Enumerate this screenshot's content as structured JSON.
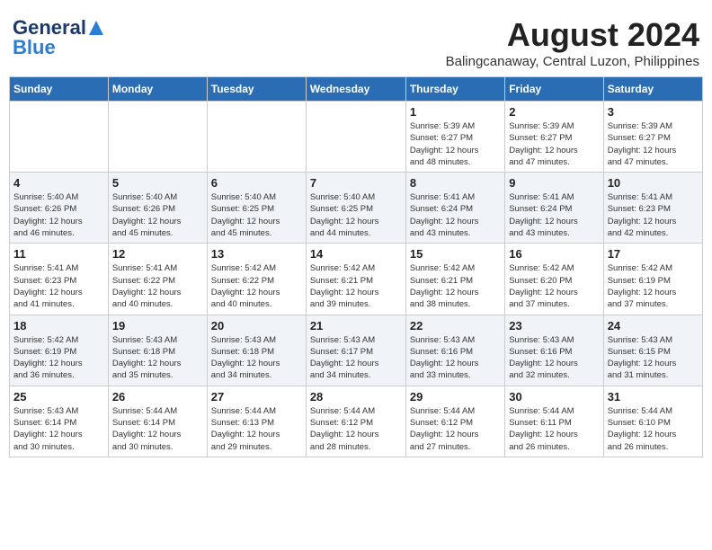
{
  "logo": {
    "line1": "General",
    "line2": "Blue"
  },
  "title": "August 2024",
  "subtitle": "Balingcanaway, Central Luzon, Philippines",
  "days_of_week": [
    "Sunday",
    "Monday",
    "Tuesday",
    "Wednesday",
    "Thursday",
    "Friday",
    "Saturday"
  ],
  "weeks": [
    [
      {
        "day": "",
        "info": ""
      },
      {
        "day": "",
        "info": ""
      },
      {
        "day": "",
        "info": ""
      },
      {
        "day": "",
        "info": ""
      },
      {
        "day": "1",
        "info": "Sunrise: 5:39 AM\nSunset: 6:27 PM\nDaylight: 12 hours\nand 48 minutes."
      },
      {
        "day": "2",
        "info": "Sunrise: 5:39 AM\nSunset: 6:27 PM\nDaylight: 12 hours\nand 47 minutes."
      },
      {
        "day": "3",
        "info": "Sunrise: 5:39 AM\nSunset: 6:27 PM\nDaylight: 12 hours\nand 47 minutes."
      }
    ],
    [
      {
        "day": "4",
        "info": "Sunrise: 5:40 AM\nSunset: 6:26 PM\nDaylight: 12 hours\nand 46 minutes."
      },
      {
        "day": "5",
        "info": "Sunrise: 5:40 AM\nSunset: 6:26 PM\nDaylight: 12 hours\nand 45 minutes."
      },
      {
        "day": "6",
        "info": "Sunrise: 5:40 AM\nSunset: 6:25 PM\nDaylight: 12 hours\nand 45 minutes."
      },
      {
        "day": "7",
        "info": "Sunrise: 5:40 AM\nSunset: 6:25 PM\nDaylight: 12 hours\nand 44 minutes."
      },
      {
        "day": "8",
        "info": "Sunrise: 5:41 AM\nSunset: 6:24 PM\nDaylight: 12 hours\nand 43 minutes."
      },
      {
        "day": "9",
        "info": "Sunrise: 5:41 AM\nSunset: 6:24 PM\nDaylight: 12 hours\nand 43 minutes."
      },
      {
        "day": "10",
        "info": "Sunrise: 5:41 AM\nSunset: 6:23 PM\nDaylight: 12 hours\nand 42 minutes."
      }
    ],
    [
      {
        "day": "11",
        "info": "Sunrise: 5:41 AM\nSunset: 6:23 PM\nDaylight: 12 hours\nand 41 minutes."
      },
      {
        "day": "12",
        "info": "Sunrise: 5:41 AM\nSunset: 6:22 PM\nDaylight: 12 hours\nand 40 minutes."
      },
      {
        "day": "13",
        "info": "Sunrise: 5:42 AM\nSunset: 6:22 PM\nDaylight: 12 hours\nand 40 minutes."
      },
      {
        "day": "14",
        "info": "Sunrise: 5:42 AM\nSunset: 6:21 PM\nDaylight: 12 hours\nand 39 minutes."
      },
      {
        "day": "15",
        "info": "Sunrise: 5:42 AM\nSunset: 6:21 PM\nDaylight: 12 hours\nand 38 minutes."
      },
      {
        "day": "16",
        "info": "Sunrise: 5:42 AM\nSunset: 6:20 PM\nDaylight: 12 hours\nand 37 minutes."
      },
      {
        "day": "17",
        "info": "Sunrise: 5:42 AM\nSunset: 6:19 PM\nDaylight: 12 hours\nand 37 minutes."
      }
    ],
    [
      {
        "day": "18",
        "info": "Sunrise: 5:42 AM\nSunset: 6:19 PM\nDaylight: 12 hours\nand 36 minutes."
      },
      {
        "day": "19",
        "info": "Sunrise: 5:43 AM\nSunset: 6:18 PM\nDaylight: 12 hours\nand 35 minutes."
      },
      {
        "day": "20",
        "info": "Sunrise: 5:43 AM\nSunset: 6:18 PM\nDaylight: 12 hours\nand 34 minutes."
      },
      {
        "day": "21",
        "info": "Sunrise: 5:43 AM\nSunset: 6:17 PM\nDaylight: 12 hours\nand 34 minutes."
      },
      {
        "day": "22",
        "info": "Sunrise: 5:43 AM\nSunset: 6:16 PM\nDaylight: 12 hours\nand 33 minutes."
      },
      {
        "day": "23",
        "info": "Sunrise: 5:43 AM\nSunset: 6:16 PM\nDaylight: 12 hours\nand 32 minutes."
      },
      {
        "day": "24",
        "info": "Sunrise: 5:43 AM\nSunset: 6:15 PM\nDaylight: 12 hours\nand 31 minutes."
      }
    ],
    [
      {
        "day": "25",
        "info": "Sunrise: 5:43 AM\nSunset: 6:14 PM\nDaylight: 12 hours\nand 30 minutes."
      },
      {
        "day": "26",
        "info": "Sunrise: 5:44 AM\nSunset: 6:14 PM\nDaylight: 12 hours\nand 30 minutes."
      },
      {
        "day": "27",
        "info": "Sunrise: 5:44 AM\nSunset: 6:13 PM\nDaylight: 12 hours\nand 29 minutes."
      },
      {
        "day": "28",
        "info": "Sunrise: 5:44 AM\nSunset: 6:12 PM\nDaylight: 12 hours\nand 28 minutes."
      },
      {
        "day": "29",
        "info": "Sunrise: 5:44 AM\nSunset: 6:12 PM\nDaylight: 12 hours\nand 27 minutes."
      },
      {
        "day": "30",
        "info": "Sunrise: 5:44 AM\nSunset: 6:11 PM\nDaylight: 12 hours\nand 26 minutes."
      },
      {
        "day": "31",
        "info": "Sunrise: 5:44 AM\nSunset: 6:10 PM\nDaylight: 12 hours\nand 26 minutes."
      }
    ]
  ]
}
